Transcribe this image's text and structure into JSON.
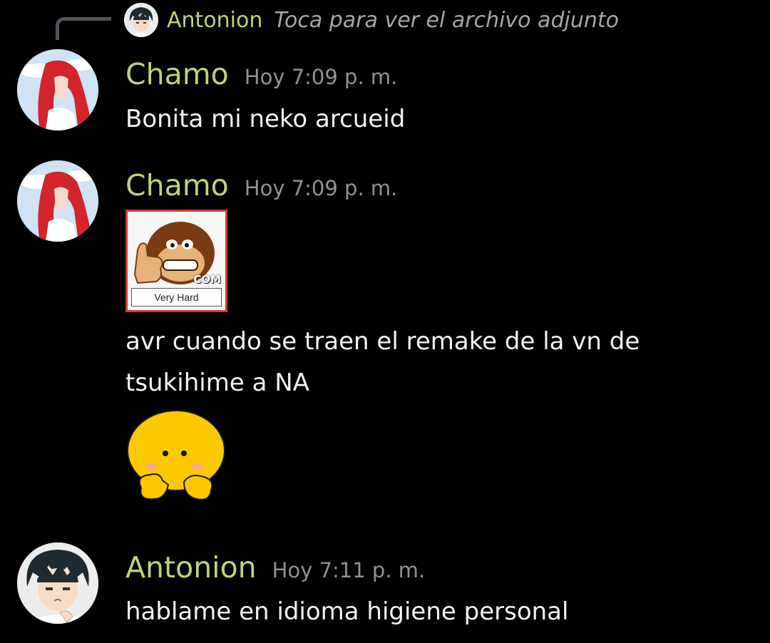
{
  "reply": {
    "author": "Antonion",
    "text": "Toca para ver el archivo adjunto",
    "avatar_icon": "anime-boy-avatar"
  },
  "messages": [
    {
      "author": "Chamo",
      "timestamp": "Hoy 7:09 p. m.",
      "avatar_icon": "red-hair-anime-girl-avatar",
      "lines": [
        "Bonita mi neko arcueid"
      ]
    },
    {
      "author": "Chamo",
      "timestamp": "Hoy 7:09 p. m.",
      "avatar_icon": "red-hair-anime-girl-avatar",
      "attachment": {
        "type": "sticker",
        "icon": "donkey-kong-thumbs-up",
        "badge": "COM",
        "caption": "Very Hard"
      },
      "lines": [
        "avr cuando se traen el remake de la vn de",
        "tsukihime a NA"
      ],
      "sticker": {
        "icon": "yellow-blob-shy-emoji"
      }
    },
    {
      "author": "Antonion",
      "timestamp": "Hoy 7:11 p. m.",
      "avatar_icon": "anime-boy-avatar",
      "lines": [
        "hablame en idioma higiene personal"
      ]
    }
  ],
  "colors": {
    "background": "#000000",
    "author": "#bcd37c",
    "timestamp": "#8e9297",
    "text": "#f2f3f5",
    "reply_text": "#a3a6aa"
  }
}
